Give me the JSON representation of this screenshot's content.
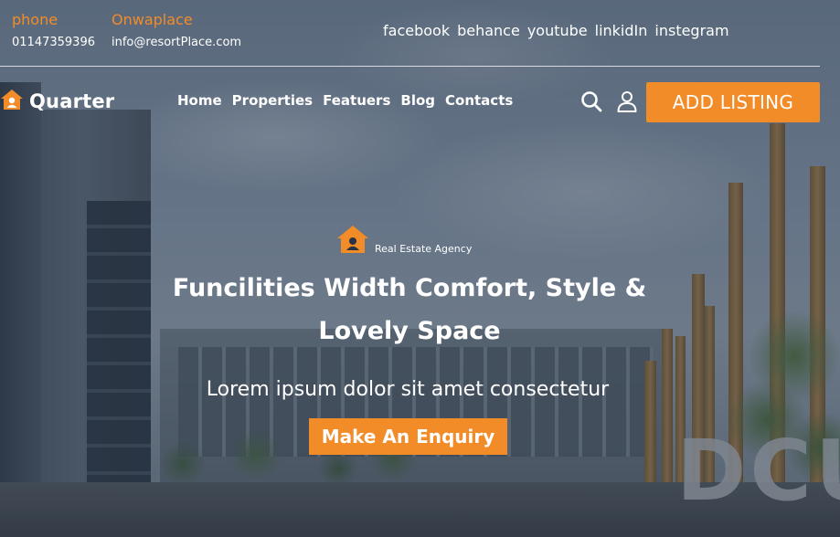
{
  "topbar": {
    "phone_label": "phone",
    "phone_value": "01147359396",
    "place_label": "Onwaplace",
    "place_value": "info@resortPlace.com",
    "social": [
      "facebook",
      "behance",
      "youtube",
      "linkidIn",
      "instegram"
    ]
  },
  "brand": {
    "name": "Quarter",
    "icon": "house-icon"
  },
  "nav": {
    "items": [
      "Home",
      "Properties",
      "Featuers",
      "Blog",
      "Contacts"
    ]
  },
  "actions": {
    "search_icon": "search-icon",
    "user_icon": "user-icon",
    "add_listing_label": "ADD LISTING"
  },
  "hero": {
    "tag_icon": "house-icon",
    "tag": "Real Estate Agency",
    "headline_line1": "Funcilities Width Comfort, Style &",
    "headline_line2": "Lovely Space",
    "subtext": "Lorem ipsum dolor sit amet consectetur",
    "cta_label": "Make An Enquiry"
  },
  "colors": {
    "accent": "#f28c28",
    "text": "#ffffff"
  }
}
